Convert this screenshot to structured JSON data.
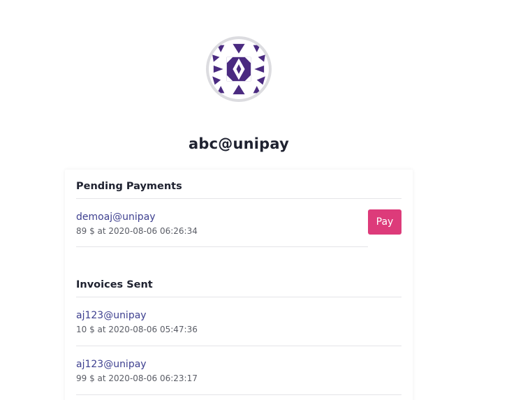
{
  "profile": {
    "username": "abc@unipay",
    "avatar_icon": "identicon-avatar",
    "avatar_color": "#4a2a80"
  },
  "pending": {
    "title": "Pending Payments",
    "items": [
      {
        "name": "demoaj@unipay",
        "meta": "89 $ at 2020-08-06 06:26:34",
        "action_label": "Pay"
      }
    ]
  },
  "invoices": {
    "title": "Invoices Sent",
    "items": [
      {
        "name": "aj123@unipay",
        "meta": "10 $ at 2020-08-06 05:47:36"
      },
      {
        "name": "aj123@unipay",
        "meta": "99 $ at 2020-08-06 06:23:17"
      }
    ]
  },
  "colors": {
    "accent": "#dd3b7a",
    "link": "#3d3f8f",
    "text": "#1f2230"
  }
}
